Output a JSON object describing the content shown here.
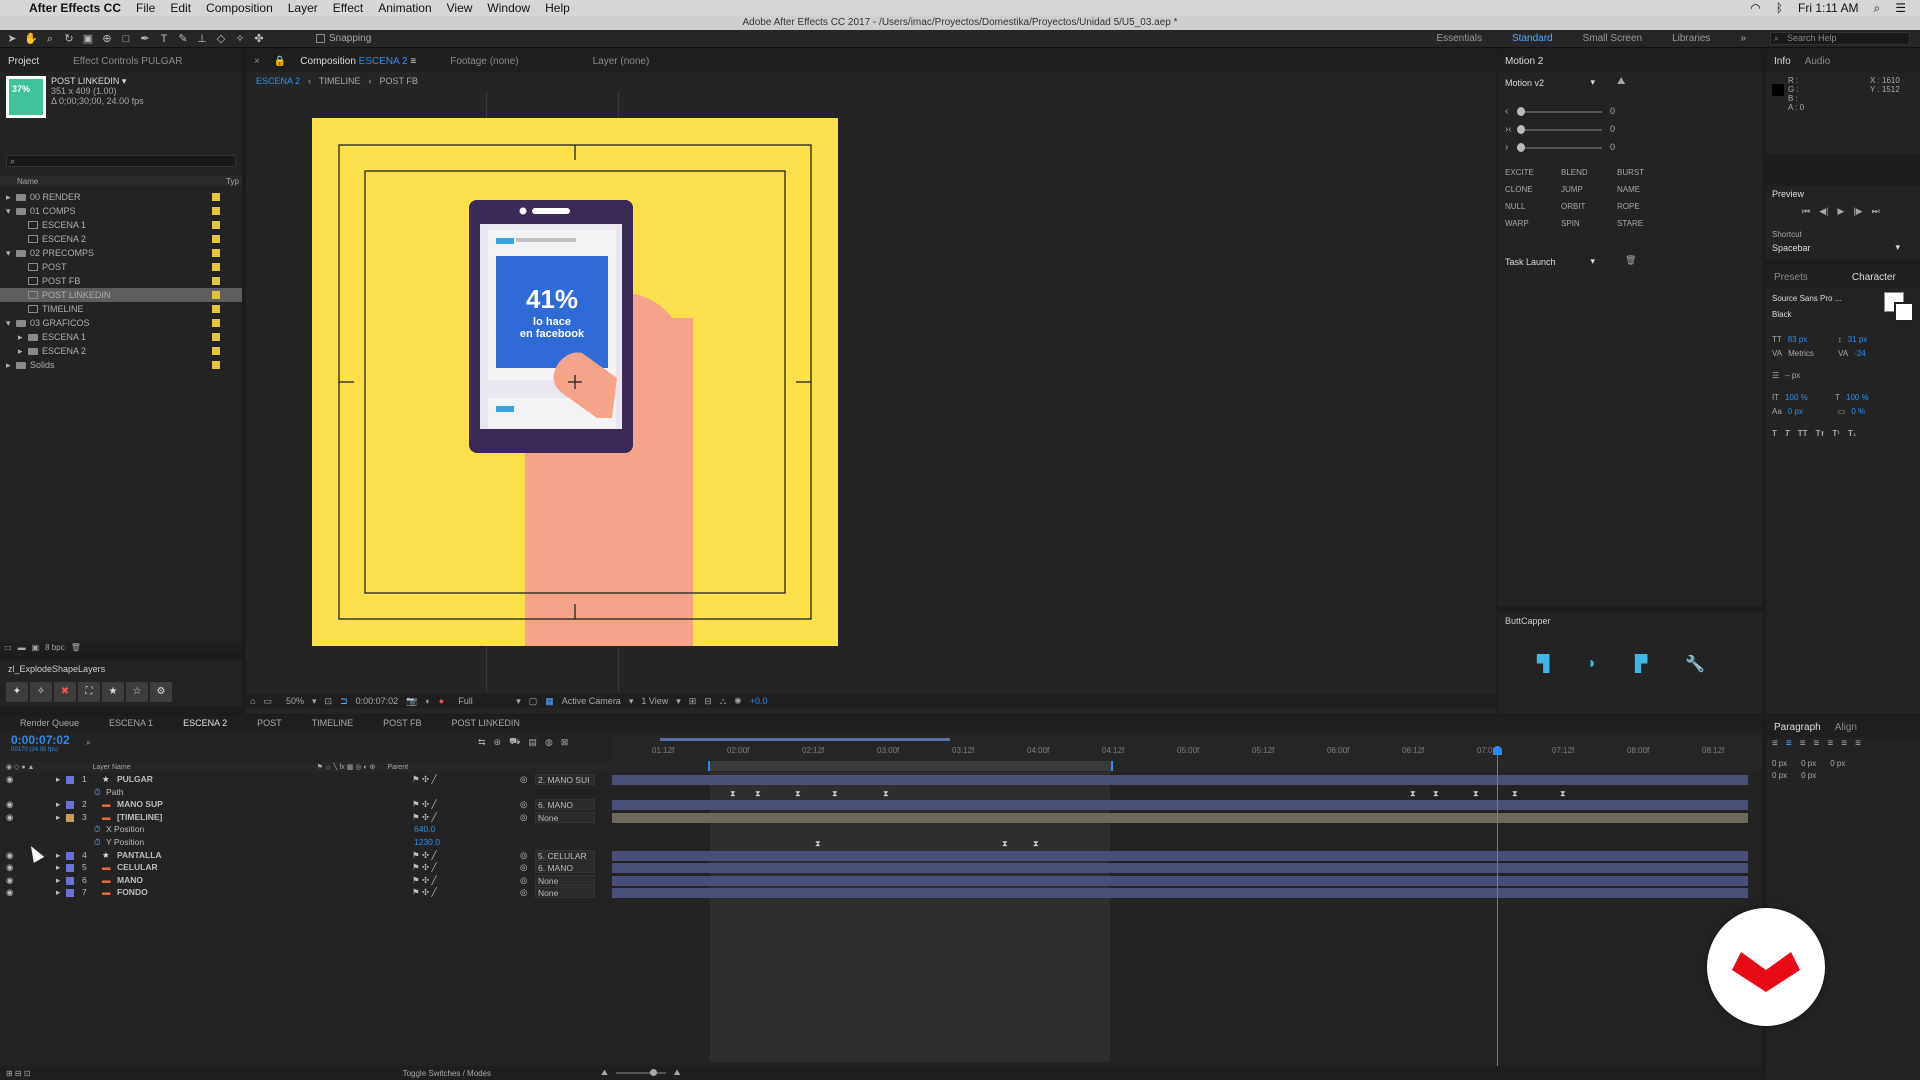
{
  "menubar": {
    "apple": "",
    "app": "After Effects CC",
    "items": [
      "File",
      "Edit",
      "Composition",
      "Layer",
      "Effect",
      "Animation",
      "View",
      "Window",
      "Help"
    ],
    "clock": "Fri 1:11 AM"
  },
  "titlebar": "Adobe After Effects CC 2017 - /Users/imac/Proyectos/Domestika/Proyectos/Unidad 5/U5_03.aep *",
  "toolbar": {
    "snapping": "Snapping",
    "workspaces": [
      "Essentials",
      "Standard",
      "Small Screen",
      "Libraries"
    ],
    "active_workspace": "Standard",
    "search_placeholder": "Search Help"
  },
  "project": {
    "tabs": [
      "Project",
      "Effect Controls PULGAR"
    ],
    "thumb_text": "37%",
    "item_name": "POST LINKEDIN ▾",
    "item_size": "351 x 409 (1.00)",
    "item_duration": "Δ 0;00;30;00, 24.00 fps",
    "col_name": "Name",
    "col_type": "Typ",
    "tree": [
      {
        "label": "00 RENDER",
        "level": 0,
        "kind": "folder",
        "open": false
      },
      {
        "label": "01 COMPS",
        "level": 0,
        "kind": "folder",
        "open": true
      },
      {
        "label": "ESCENA 1",
        "level": 1,
        "kind": "comp"
      },
      {
        "label": "ESCENA 2",
        "level": 1,
        "kind": "comp"
      },
      {
        "label": "02 PRECOMPS",
        "level": 0,
        "kind": "folder",
        "open": true
      },
      {
        "label": "POST",
        "level": 1,
        "kind": "comp"
      },
      {
        "label": "POST FB",
        "level": 1,
        "kind": "comp"
      },
      {
        "label": "POST LINKEDIN",
        "level": 1,
        "kind": "comp",
        "selected": true
      },
      {
        "label": "TIMELINE",
        "level": 1,
        "kind": "comp"
      },
      {
        "label": "03 GRAFICOS",
        "level": 0,
        "kind": "folder",
        "open": true
      },
      {
        "label": "ESCENA 1",
        "level": 1,
        "kind": "folder"
      },
      {
        "label": "ESCENA 2",
        "level": 1,
        "kind": "folder"
      },
      {
        "label": "Solids",
        "level": 0,
        "kind": "folder",
        "open": false
      }
    ],
    "bpc": "8 bpc",
    "script_panel": "zl_ExplodeShapeLayers"
  },
  "composition": {
    "tab_label": "Composition",
    "tab_comp": "ESCENA 2",
    "footage": "Footage (none)",
    "layer": "Layer (none)",
    "breadcrumbs": [
      "ESCENA 2",
      "TIMELINE",
      "POST FB"
    ],
    "artwork_big": "41%",
    "artwork_line1": "lo hace",
    "artwork_line2": "en facebook",
    "zoom": "50%",
    "timecode": "0:00:07:02",
    "resolution": "Full",
    "camera": "Active Camera",
    "views": "1 View",
    "exposure": "+0.0",
    "colors": {
      "bg_yellow": "#fbe04b",
      "phone_frame": "#3b2a55",
      "screen_blue": "#2f6bd6",
      "hand": "#f5a48a"
    }
  },
  "motion": {
    "title": "Motion 2",
    "preset": "Motion v2",
    "sliders": [
      "0",
      "0",
      "0"
    ],
    "buttons": [
      "EXCITE",
      "BLEND",
      "BURST",
      "CLONE",
      "JUMP",
      "NAME",
      "NULL",
      "ORBIT",
      "ROPE",
      "WARP",
      "SPIN",
      "STARE"
    ],
    "task": "Task Launch"
  },
  "buttcapper": {
    "title": "ButtCapper"
  },
  "info": {
    "tabs": [
      "Info",
      "Audio"
    ],
    "rgb": [
      "R :",
      "G :",
      "B :",
      "A : 0"
    ],
    "x": "X : 1610",
    "y": "Y : 1512"
  },
  "preview": {
    "title": "Preview",
    "shortcut_label": "Shortcut",
    "shortcut": "Spacebar"
  },
  "character": {
    "tabs": [
      "Presets",
      "Character"
    ],
    "font": "Source Sans Pro ...",
    "style": "Black",
    "size": "83 px",
    "leading": "31 px",
    "kerning": "Metrics",
    "tracking": "-24",
    "stroke": "– px",
    "vscale": "100 %",
    "hscale": "100 %",
    "baseline": "0 px",
    "tsume": "0 %"
  },
  "paragraph": {
    "tabs": [
      "Paragraph",
      "Align"
    ],
    "indents": [
      "0 px",
      "0 px",
      "0 px",
      "0 px",
      "0 px"
    ]
  },
  "timeline": {
    "tabs": [
      "Render Queue",
      "ESCENA 1",
      "ESCENA 2",
      "POST",
      "TIMELINE",
      "POST FB",
      "POST LINKEDIN"
    ],
    "active_tab": "ESCENA 2",
    "timecode": "0:00:07:02",
    "frame": "00170 (24.00 fps)",
    "col_layer": "Layer Name",
    "col_parent": "Parent",
    "ruler": [
      "01:12f",
      "02:00f",
      "02:12f",
      "03:00f",
      "03:12f",
      "04:00f",
      "04:12f",
      "05:00f",
      "05:12f",
      "06:00f",
      "06:12f",
      "07:00f",
      "07:12f",
      "08:00f",
      "08:12f"
    ],
    "layers": [
      {
        "num": "1",
        "name": "PULGAR",
        "parent": "2. MANO SUI",
        "star": true,
        "color": "#6a72d8"
      },
      {
        "num": "",
        "name": "Path",
        "sub": true
      },
      {
        "num": "2",
        "name": "MANO SUP",
        "parent": "6. MANO",
        "color": "#6a72d8"
      },
      {
        "num": "3",
        "name": "[TIMELINE]",
        "parent": "None",
        "color": "#c4a05a"
      },
      {
        "num": "",
        "name": "X Position",
        "value": "640.0",
        "sub": true
      },
      {
        "num": "",
        "name": "Y Position",
        "value": "1230.0",
        "sub": true
      },
      {
        "num": "4",
        "name": "PANTALLA",
        "parent": "5. CELULAR",
        "star": true,
        "color": "#6a72d8"
      },
      {
        "num": "5",
        "name": "CELULAR",
        "parent": "6. MANO",
        "color": "#6a72d8"
      },
      {
        "num": "6",
        "name": "MANO",
        "parent": "None",
        "color": "#6a72d8"
      },
      {
        "num": "7",
        "name": "FONDO",
        "parent": "None",
        "color": "#6a72d8"
      }
    ],
    "toggle": "Toggle Switches / Modes"
  }
}
